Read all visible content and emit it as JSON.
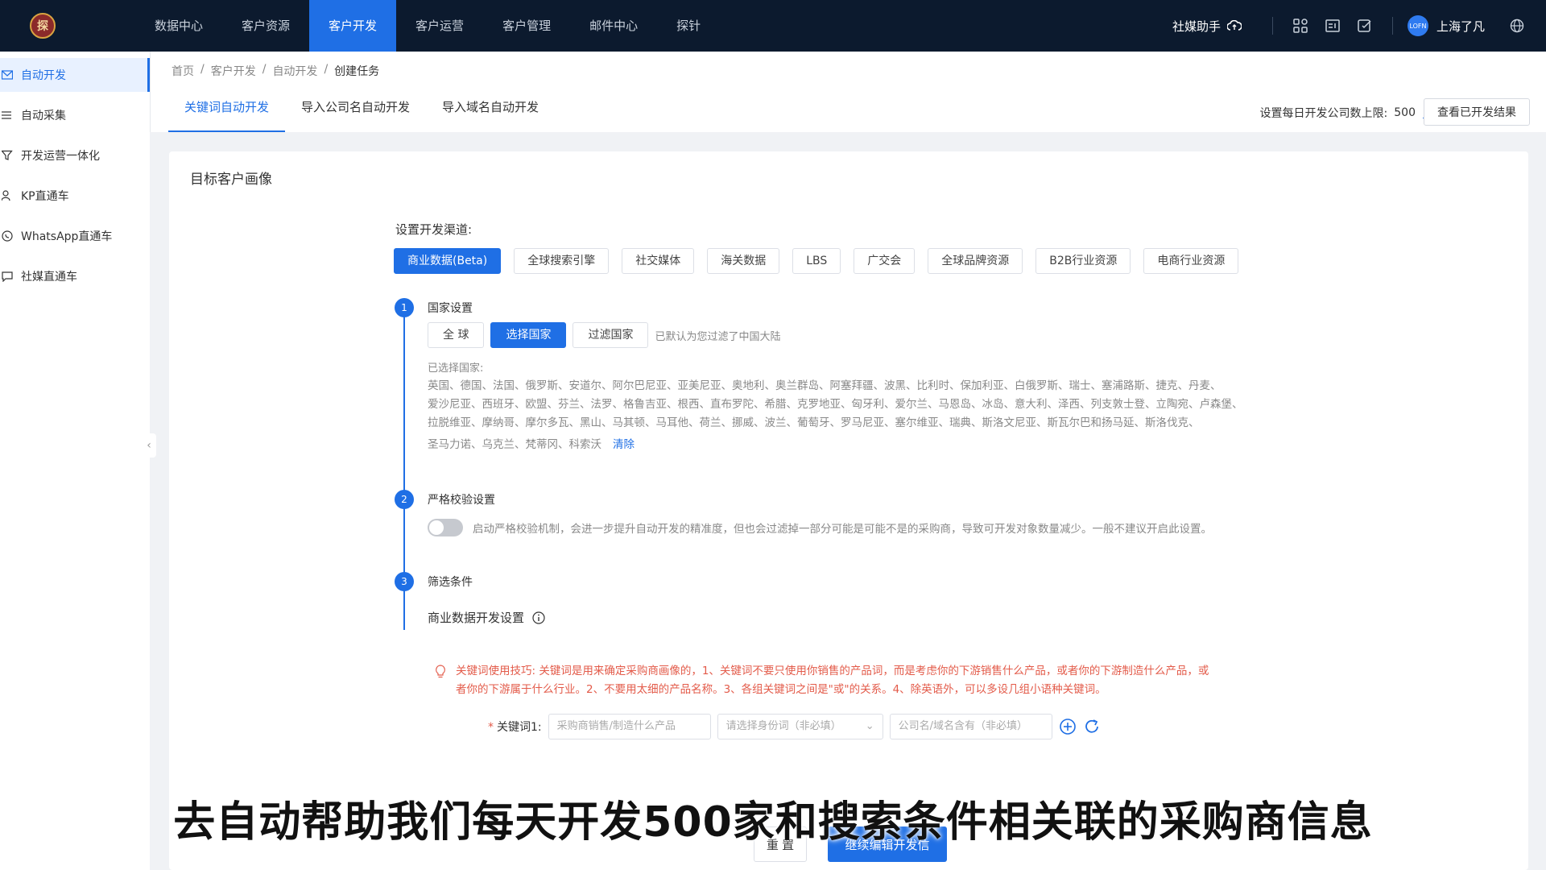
{
  "nav": {
    "items": [
      "数据中心",
      "客户资源",
      "客户开发",
      "客户运营",
      "客户管理",
      "邮件中心",
      "探针"
    ],
    "active_index": 2
  },
  "topbar": {
    "helper_label": "社媒助手",
    "user_name": "上海了凡",
    "avatar_text": "LOFN"
  },
  "sidebar": {
    "items": [
      {
        "label": "自动开发",
        "icon": "mail-icon"
      },
      {
        "label": "自动采集",
        "icon": "list-icon"
      },
      {
        "label": "开发运营一体化",
        "icon": "funnel-icon"
      },
      {
        "label": "KP直通车",
        "icon": "person-search-icon"
      },
      {
        "label": "WhatsApp直通车",
        "icon": "whatsapp-icon"
      },
      {
        "label": "社媒直通车",
        "icon": "chat-icon"
      }
    ]
  },
  "breadcrumb": [
    "首页",
    "客户开发",
    "自动开发",
    "创建任务"
  ],
  "tabs": [
    "关键词自动开发",
    "导入公司名自动开发",
    "导入域名自动开发"
  ],
  "limit": {
    "label": "设置每日开发公司数上限:",
    "value": "500"
  },
  "view_results_label": "查看已开发结果",
  "card": {
    "title": "目标客户画像",
    "channel_label": "设置开发渠道:",
    "channels": [
      "商业数据(Beta)",
      "全球搜索引擎",
      "社交媒体",
      "海关数据",
      "LBS",
      "广交会",
      "全球品牌资源",
      "B2B行业资源",
      "电商行业资源"
    ],
    "active_channel_index": 0
  },
  "step1": {
    "number": "1",
    "title": "国家设置",
    "buttons": [
      "全 球",
      "选择国家",
      "过滤国家"
    ],
    "active_button_index": 1,
    "filter_note": "已默认为您过滤了中国大陆",
    "selected_label": "已选择国家:",
    "countries_line1": "英国、德国、法国、俄罗斯、安道尔、阿尔巴尼亚、亚美尼亚、奥地利、奥兰群岛、阿塞拜疆、波黑、比利时、保加利亚、白俄罗斯、瑞士、塞浦路斯、捷克、丹麦、",
    "countries_line2": "爱沙尼亚、西班牙、欧盟、芬兰、法罗、格鲁吉亚、根西、直布罗陀、希腊、克罗地亚、匈牙利、爱尔兰、马恩岛、冰岛、意大利、泽西、列支敦士登、立陶宛、卢森堡、",
    "countries_line3": "拉脱维亚、摩纳哥、摩尔多瓦、黑山、马其顿、马耳他、荷兰、挪威、波兰、葡萄牙、罗马尼亚、塞尔维亚、瑞典、斯洛文尼亚、斯瓦尔巴和扬马延、斯洛伐克、",
    "countries_line4": "圣马力诺、乌克兰、梵蒂冈、科索沃",
    "clear_label": "清除"
  },
  "step2": {
    "number": "2",
    "title": "严格校验设置",
    "toggle_text": "启动严格校验机制，会进一步提升自动开发的精准度，但也会过滤掉一部分可能是可能不是的采购商，导致可开发对象数量减少。一般不建议开启此设置。"
  },
  "step3": {
    "number": "3",
    "title": "筛选条件",
    "biz_label": "商业数据开发设置",
    "tip_line1": "关键词使用技巧: 关键词是用来确定采购商画像的，1、关键词不要只使用你销售的产品词，而是考虑你的下游销售什么产品，或者你的下游制造什么产品，或",
    "tip_line2": "者你的下游属于什么行业。2、不要用太细的产品名称。3、各组关键词之间是\"或\"的关系。4、除英语外，可以多设几组小语种关键词。",
    "kw_label": "关键词1:",
    "kw_placeholder": "采购商销售/制造什么产品",
    "kw_role_placeholder": "请选择身份词（非必填）",
    "kw_company_placeholder": "公司名/域名含有（非必填）"
  },
  "buttons": {
    "reset": "重 置",
    "submit": "继续编辑开发信"
  },
  "subtitle": "去自动帮助我们每天开发500家和搜索条件相关联的采购商信息",
  "colors": {
    "primary": "#1f6fe5",
    "topbar": "#0c1a2e",
    "tip": "#e35b4a"
  }
}
